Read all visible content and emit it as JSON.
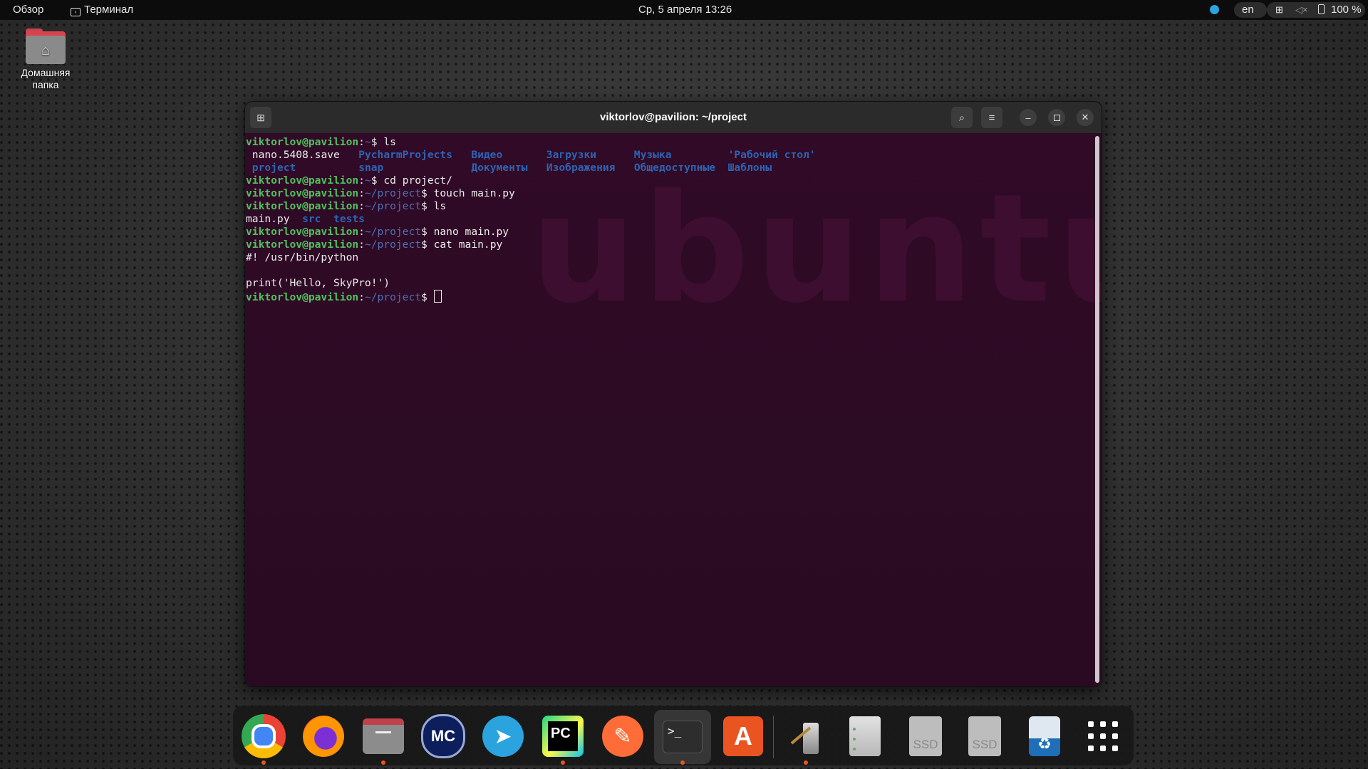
{
  "topbar": {
    "activities": "Обзор",
    "app_menu": "Терминал",
    "clock": "Ср, 5 апреля  13:26",
    "keyboard_layout": "en",
    "battery": "100 %"
  },
  "desktop": {
    "home_folder_label_1": "Домашняя",
    "home_folder_label_2": "папка"
  },
  "terminal": {
    "title": "viktorlov@pavilion: ~/project",
    "user": "viktorlov@pavilion",
    "home_path": "~",
    "project_path": "~/project",
    "lines": [
      {
        "prompt_path": "~",
        "cmd": " ls"
      },
      {
        "ls_row": [
          "nano.5408.save",
          "PycharmProjects",
          "Видео",
          "Загрузки",
          "Музыка",
          "'Рабочий стол'"
        ]
      },
      {
        "ls_row": [
          "project",
          "snap",
          "Документы",
          "Изображения",
          "Общедоступные",
          "Шаблоны"
        ]
      },
      {
        "prompt_path": "~",
        "cmd": " cd project/"
      },
      {
        "prompt_path": "~/project",
        "cmd": " touch main.py"
      },
      {
        "prompt_path": "~/project",
        "cmd": " ls"
      },
      {
        "ls_row2": [
          "main.py",
          "src",
          "tests"
        ]
      },
      {
        "prompt_path": "~/project",
        "cmd": " nano main.py"
      },
      {
        "prompt_path": "~/project",
        "cmd": " cat main.py"
      },
      {
        "output": "#! /usr/bin/python"
      },
      {
        "output": ""
      },
      {
        "output": "print('Hello, SkyPro!')"
      },
      {
        "prompt_path": "~/project",
        "cmd": " "
      }
    ],
    "watermark": "ubuntu"
  },
  "dock": {
    "apps": [
      {
        "name": "chrome",
        "running": true
      },
      {
        "name": "firefox",
        "running": false
      },
      {
        "name": "files",
        "running": true
      },
      {
        "name": "midnight-commander",
        "label": "MC",
        "running": false
      },
      {
        "name": "telegram",
        "running": false
      },
      {
        "name": "pycharm",
        "label": "PC",
        "running": true
      },
      {
        "name": "postman",
        "running": false
      },
      {
        "name": "terminal",
        "label": ">_",
        "running": true,
        "active": true
      },
      {
        "name": "app-center",
        "label": "A",
        "running": false
      },
      {
        "name": "text-editor",
        "running": true
      },
      {
        "name": "disk-usage",
        "running": false
      },
      {
        "name": "ssd-drive-1",
        "label": "SSD",
        "running": false
      },
      {
        "name": "ssd-drive-2",
        "label": "SSD",
        "running": false
      },
      {
        "name": "trash",
        "running": false
      },
      {
        "name": "show-apps",
        "running": false
      }
    ]
  },
  "colors": {
    "ubuntu_orange": "#e95420",
    "terminal_bg": "#300a26",
    "prompt_user": "#4fc25d",
    "prompt_path": "#4e6fb5"
  }
}
